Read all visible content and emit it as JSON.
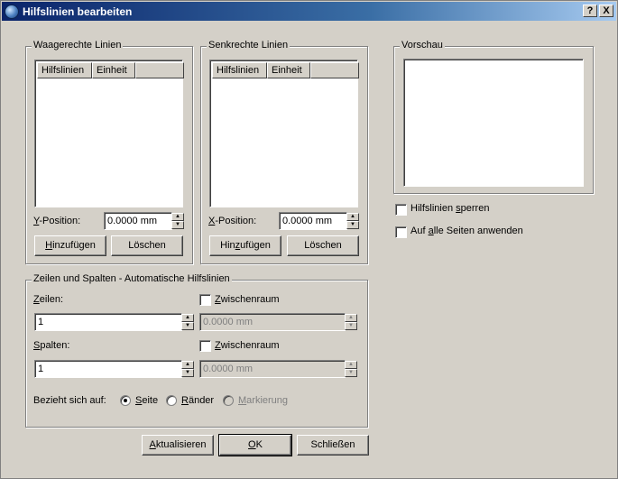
{
  "window": {
    "title": "Hilfslinien bearbeiten",
    "help_btn": "?",
    "close_btn": "X"
  },
  "horizontal": {
    "title": "Waagerechte Linien",
    "col1": "Hilfslinien",
    "col2": "Einheit",
    "pos_label": "Y-Position:",
    "pos_value": "0.0000 mm",
    "add_btn": "Hinzufügen",
    "delete_btn": "Löschen"
  },
  "vertical": {
    "title": "Senkrechte Linien",
    "col1": "Hilfslinien",
    "col2": "Einheit",
    "pos_label": "X-Position:",
    "pos_value": "0.0000 mm",
    "add_btn": "Hinzufügen",
    "delete_btn": "Löschen"
  },
  "preview": {
    "title": "Vorschau"
  },
  "options": {
    "lock_guides": "Hilfslinien sperren",
    "apply_all": "Auf alle Seiten anwenden"
  },
  "auto": {
    "title": "Zeilen und Spalten - Automatische Hilfslinien",
    "rows_label": "Zeilen:",
    "rows_value": "1",
    "cols_label": "Spalten:",
    "cols_value": "1",
    "gap_label": "Zwischenraum",
    "gap_value": "0.0000 mm",
    "refer_label": "Bezieht sich auf:",
    "radio_page": "Seite",
    "radio_margins": "Ränder",
    "radio_selection": "Markierung"
  },
  "footer": {
    "update_btn": "Aktualisieren",
    "ok_btn": "OK",
    "close_btn": "Schließen"
  }
}
